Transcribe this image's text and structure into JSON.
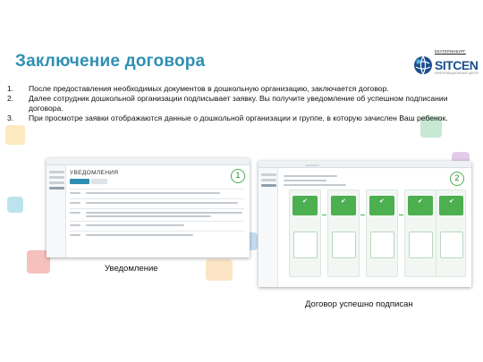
{
  "slide": {
    "title": "Заключение договора",
    "logo": {
      "top": "ЕКАТЕРИНБУРГ",
      "word": "SITCEN",
      "sub": "ИНФОРМАЦИОННЫЙ ЦЕНТР"
    },
    "list": [
      {
        "num": "1.",
        "text": "После предоставления необходимых документов в дошкольную организацию, заключается договор."
      },
      {
        "num": "2.",
        "text": "Далее сотрудник дошкольной организации подписывает заявку. Вы получите уведомление об успешном подписании договора."
      },
      {
        "num": "3.",
        "text": "При просмотре заявки отображаются данные о дошкольной организации и группе, в которую зачислен Ваш ребенок."
      }
    ],
    "shot1": {
      "heading": "УВЕДОМЛЕНИЯ",
      "badge": "1",
      "caption": "Уведомление"
    },
    "shot2": {
      "badge": "2",
      "caption": "Договор успешно подписан"
    },
    "colors": {
      "title": "#2f8fb2",
      "accent_green": "#4caf50",
      "brand_blue": "#1b4f8f"
    }
  }
}
